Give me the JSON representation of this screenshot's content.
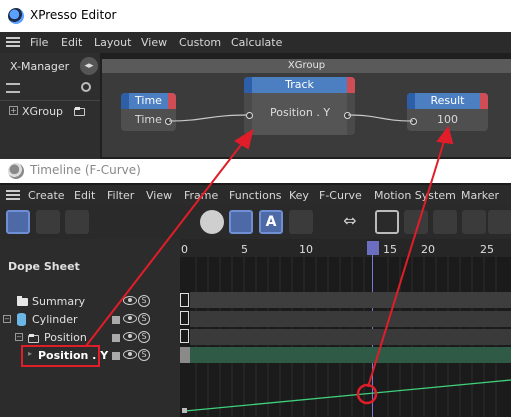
{
  "xpresso": {
    "title": "XPresso Editor",
    "menu": [
      "File",
      "Edit",
      "Layout",
      "View",
      "Custom",
      "Calculate"
    ],
    "xmanager_label": "X-Manager",
    "tree_item": "XGroup",
    "group_title": "XGroup",
    "nodes": {
      "time": {
        "title": "Time",
        "port": "Time"
      },
      "track": {
        "title": "Track",
        "port": "Position . Y"
      },
      "result": {
        "title": "Result",
        "value": "100"
      }
    }
  },
  "timeline": {
    "title": "Timeline (F-Curve)",
    "menu": [
      "Create",
      "Edit",
      "Filter",
      "View",
      "Frame",
      "Functions",
      "Key",
      "F-Curve",
      "Motion System",
      "Marker"
    ],
    "panel_label": "Dope Sheet",
    "frames": [
      "0",
      "5",
      "10",
      "15",
      "20",
      "25"
    ],
    "rows": {
      "summary": "Summary",
      "cylinder": "Cylinder",
      "position": "Position",
      "position_y": "Position . Y"
    },
    "s_badge": "S"
  },
  "colors": {
    "node_header": "#4b7fc2",
    "port_out": "#d04d55",
    "annotation": "#e11d2a",
    "curve": "#3fd07a"
  }
}
